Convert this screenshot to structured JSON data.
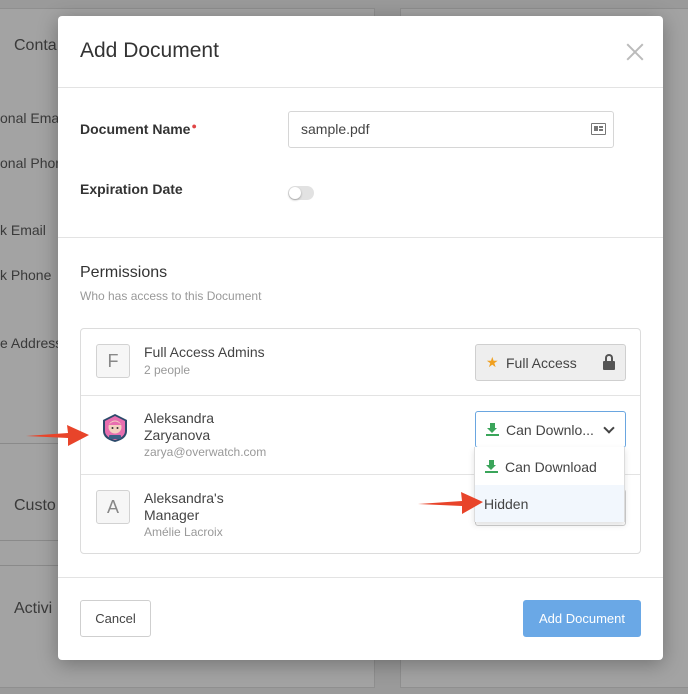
{
  "background": {
    "left_labels": [
      "Conta",
      "onal Ema",
      "onal Phon",
      "k Email",
      "k Phone",
      "e Address",
      "Custo",
      "Activi"
    ]
  },
  "modal": {
    "title": "Add Document",
    "document_name_label": "Document Name",
    "document_name_value": "sample.pdf",
    "expiration_label": "Expiration Date",
    "expiration_enabled": false,
    "permissions_title": "Permissions",
    "permissions_subtitle": "Who has access to this Document",
    "rows": [
      {
        "avatar_letter": "F",
        "name": "Full Access Admins",
        "sub": "2 people",
        "access": "Full Access"
      },
      {
        "name_line1": "Aleksandra",
        "name_line2": "Zaryanova",
        "sub": "zarya@overwatch.com",
        "access": "Can Downlo..."
      },
      {
        "avatar_letter": "A",
        "name_line1": "Aleksandra's",
        "name_line2": "Manager",
        "sub": "Amélie Lacroix"
      }
    ],
    "dropdown_options": [
      "Can Download",
      "Hidden"
    ],
    "cancel_label": "Cancel",
    "submit_label": "Add Document"
  },
  "colors": {
    "accent": "#6aa8e6",
    "download_green": "#3aa55a",
    "arrow_red": "#e8442a",
    "star": "#f0a020"
  }
}
